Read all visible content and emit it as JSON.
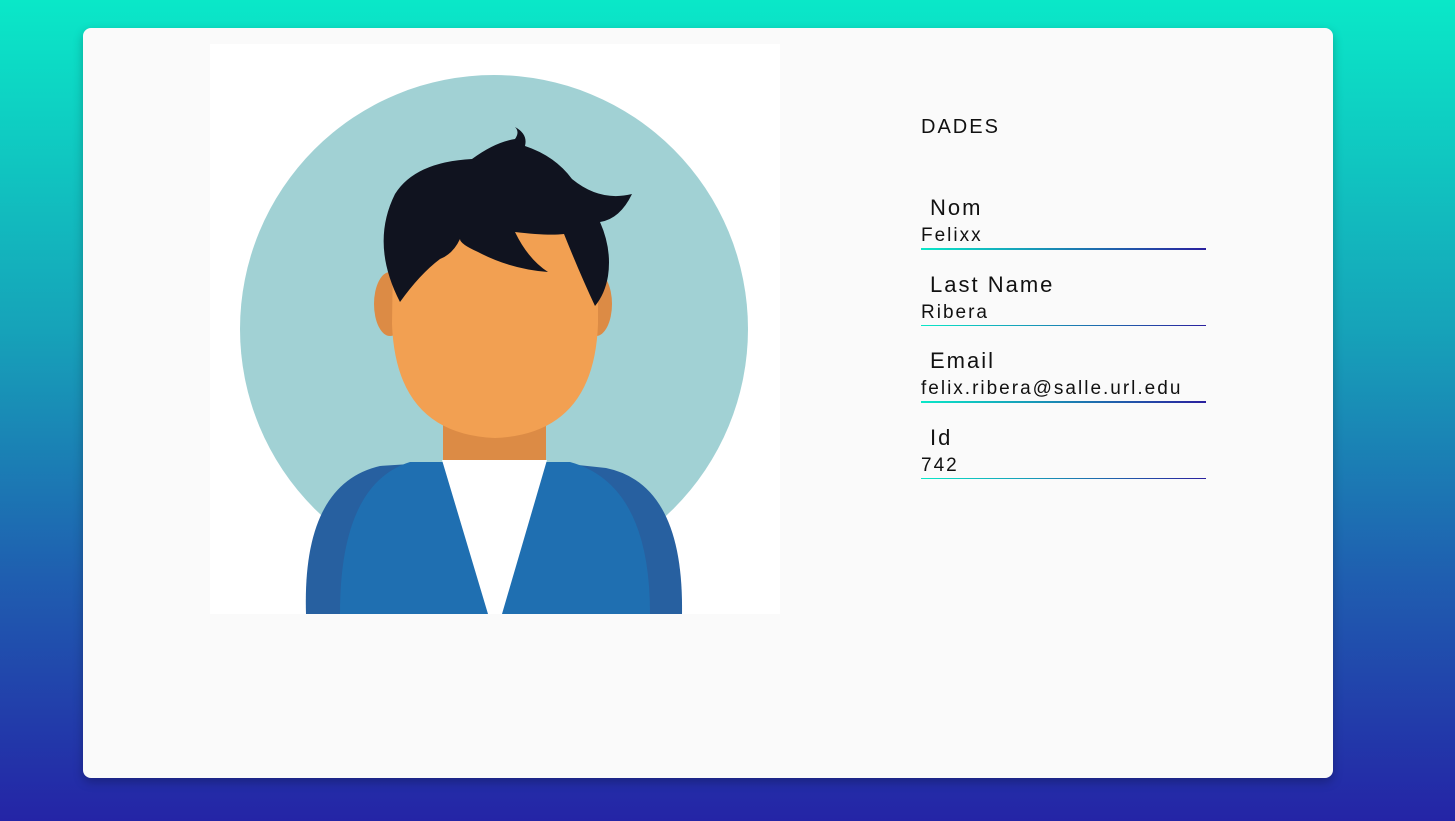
{
  "profile": {
    "section_title": "DADES",
    "fields": [
      {
        "label": "Nom",
        "value": "Felixx"
      },
      {
        "label": "Last Name",
        "value": "Ribera"
      },
      {
        "label": "Email",
        "value": "felix.ribera@salle.url.edu"
      },
      {
        "label": "Id",
        "value": "742"
      }
    ]
  },
  "avatar": {
    "icon": "user-avatar-illustration",
    "colors": {
      "circle": "#a1d1d4",
      "skin": "#f2a052",
      "skin_shadow": "#dc8b45",
      "hair": "#10131f",
      "jacket": "#1f6fb1",
      "jacket_dark": "#2760a0",
      "shirt": "#ffffff"
    }
  },
  "theme": {
    "gradient_top": "#0ae8c8",
    "gradient_bottom": "#2424a6",
    "card_bg": "#fafafa"
  }
}
